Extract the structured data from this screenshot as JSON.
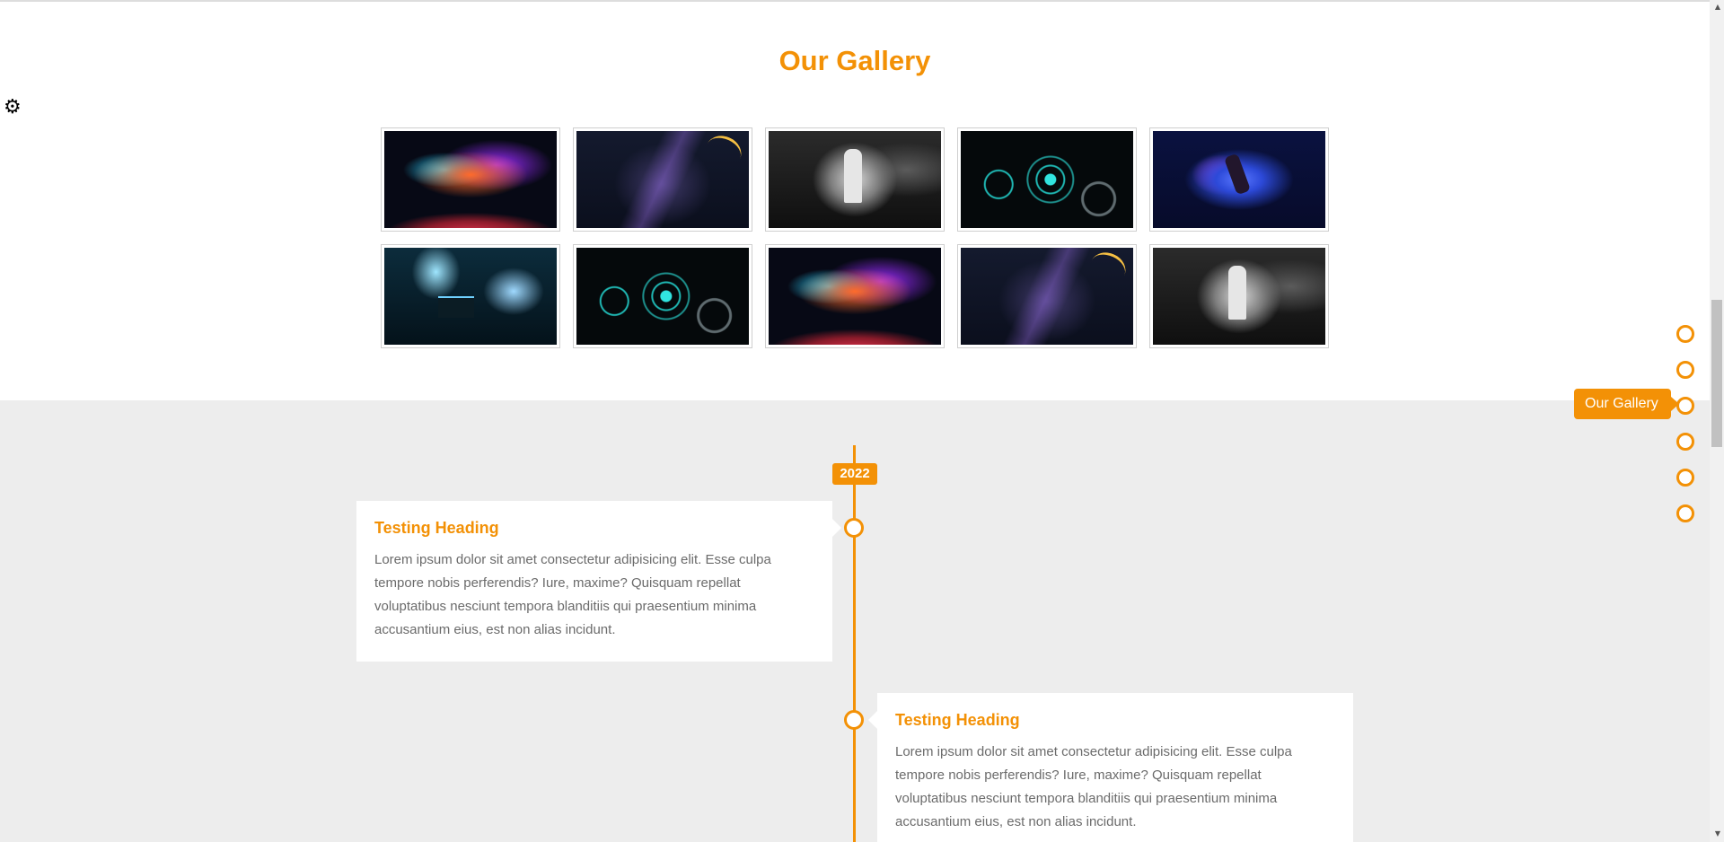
{
  "colors": {
    "accent": "#f39106",
    "section_bg": "#ededed",
    "text_muted": "#6b6b6b"
  },
  "gallery": {
    "title": "Our Gallery",
    "settings_icon": "gear-icon",
    "images": [
      {
        "name": "gallery-image-nebula-1",
        "art": "nebula"
      },
      {
        "name": "gallery-image-cyber-1",
        "art": "cyber"
      },
      {
        "name": "gallery-image-mono-1",
        "art": "mono"
      },
      {
        "name": "gallery-image-hud-1",
        "art": "hud"
      },
      {
        "name": "gallery-image-blue-1",
        "art": "blue"
      },
      {
        "name": "gallery-image-room-1",
        "art": "room"
      },
      {
        "name": "gallery-image-hud-2",
        "art": "hud"
      },
      {
        "name": "gallery-image-nebula-2",
        "art": "nebula"
      },
      {
        "name": "gallery-image-cyber-2",
        "art": "cyber"
      },
      {
        "name": "gallery-image-mono-2",
        "art": "mono"
      }
    ]
  },
  "section_nav": {
    "active_tooltip": "Our Gallery",
    "dot_count": 6,
    "active_index": 2
  },
  "timeline": {
    "year": "2022",
    "entries": [
      {
        "heading": "Testing Heading",
        "text": "Lorem ipsum dolor sit amet consectetur adipisicing elit. Esse culpa tempore nobis perferendis? Iure, maxime? Quisquam repellat voluptatibus nesciunt tempora blanditiis qui praesentium minima accusantium eius, est non alias incidunt."
      },
      {
        "heading": "Testing Heading",
        "text": "Lorem ipsum dolor sit amet consectetur adipisicing elit. Esse culpa tempore nobis perferendis? Iure, maxime? Quisquam repellat voluptatibus nesciunt tempora blanditiis qui praesentium minima accusantium eius, est non alias incidunt."
      }
    ]
  }
}
